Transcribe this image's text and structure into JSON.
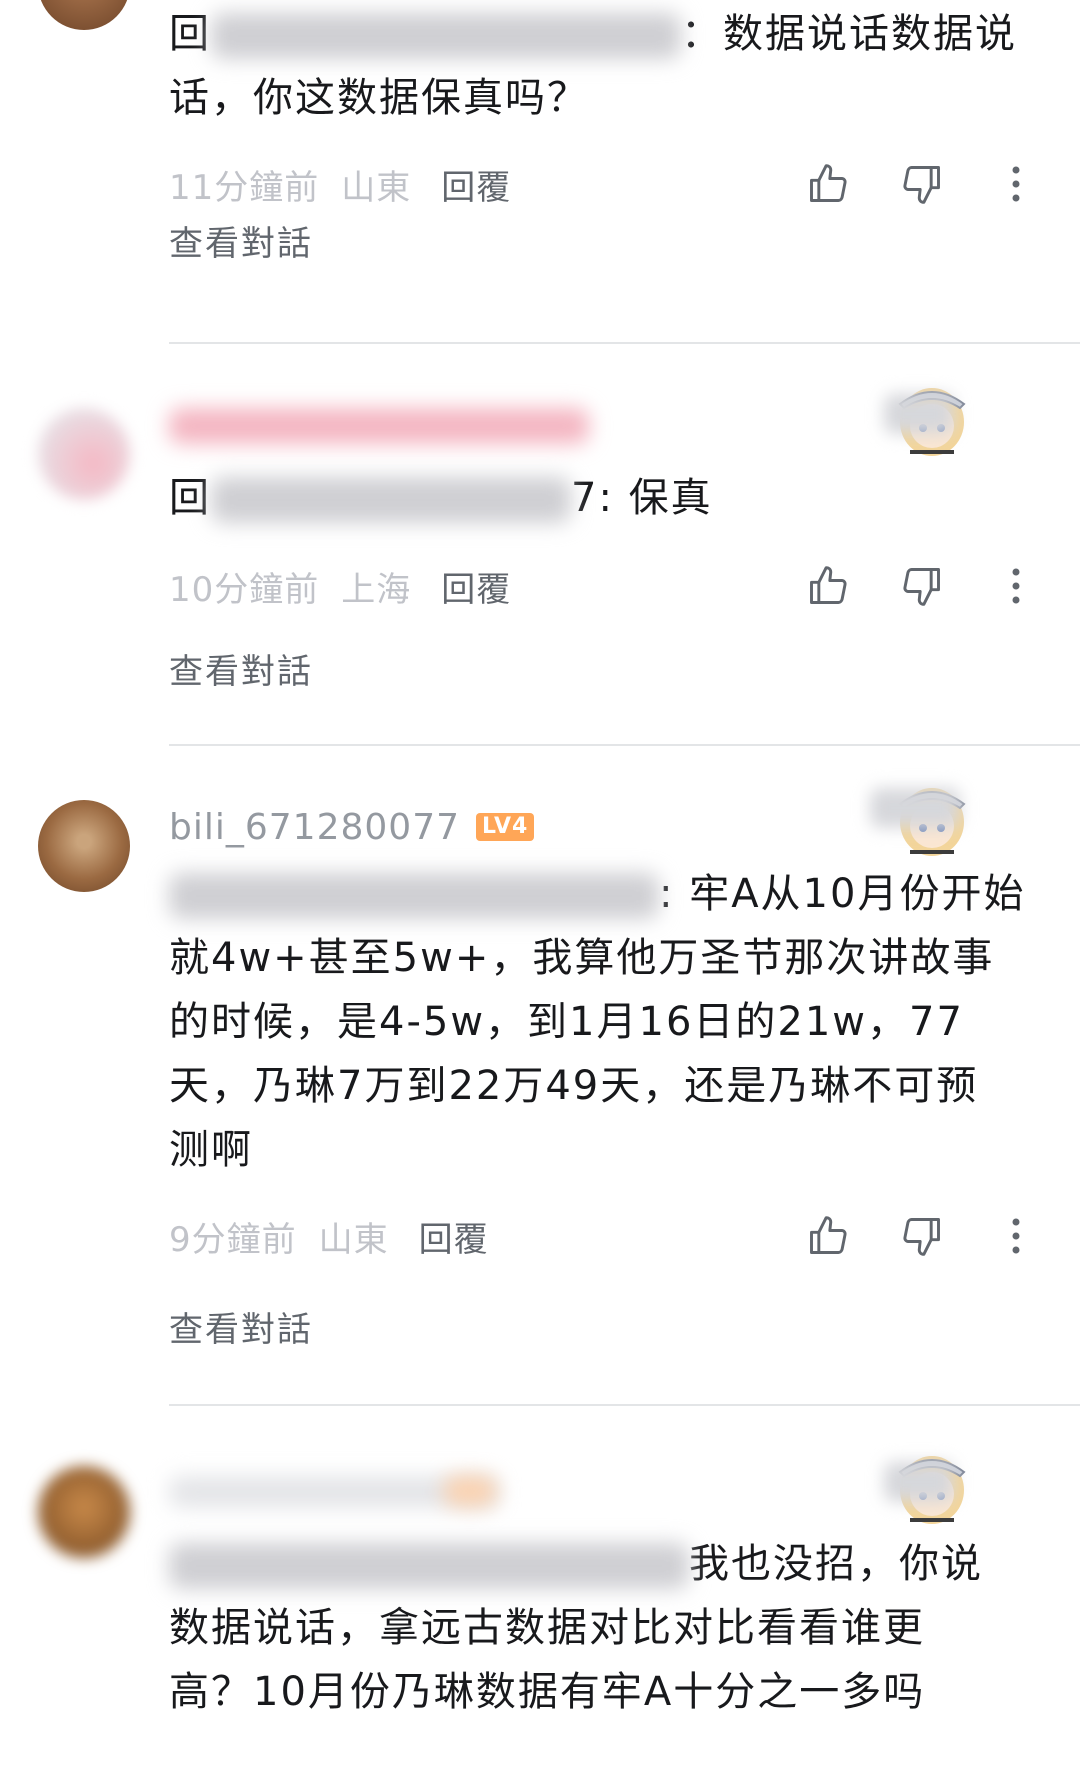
{
  "colors": {
    "text": "#18191c",
    "meta": "#c1c3c9",
    "secondary": "#61666d",
    "level_badge": "#ffa657",
    "divider": "#e3e5e7"
  },
  "comments": [
    {
      "prefix_visible": "回",
      "text_visible": "：数据说话数据说",
      "text_line2": "话，你这数据保真吗？",
      "time": "11分鐘前",
      "location": "山東",
      "reply_label": "回覆",
      "view_dialog": "查看對話"
    },
    {
      "prefix_visible": "回",
      "text_visible": "7: 保真",
      "time": "10分鐘前",
      "location": "上海",
      "reply_label": "回覆",
      "view_dialog": "查看對話"
    },
    {
      "username": "bili_671280077",
      "level": "LV4",
      "text_line1": ": 牢A从10月份开始",
      "text_line2": "就4w+甚至5w+，我算他万圣节那次讲故事",
      "text_line3": "的时候，是4-5w，到1月16日的21w，77",
      "text_line4": "天，乃琳7万到22万49天，还是乃琳不可预",
      "text_line5": "测啊",
      "time": "9分鐘前",
      "location": "山東",
      "reply_label": "回覆",
      "view_dialog": "查看對話"
    },
    {
      "text_line1": "我也没招，你说",
      "text_line2": "数据说话，拿远古数据对比对比看看谁更",
      "text_line3": "高？10月份乃琳数据有牢A十分之一多吗"
    }
  ],
  "icons": {
    "like": "thumbs-up-icon",
    "dislike": "thumbs-down-icon",
    "more": "more-vertical-icon"
  }
}
